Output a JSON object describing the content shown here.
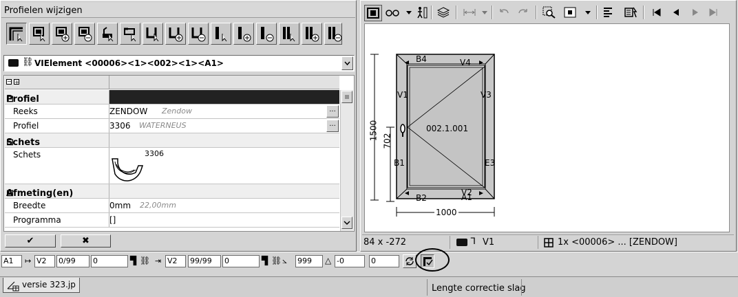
{
  "left_panel": {
    "title": "Profielen wijzigen",
    "toolbar_icons": [
      "frame-select-icon",
      "window-select-icon",
      "window-add-icon",
      "window-remove-icon",
      "sash-select-icon",
      "profile-select-icon",
      "bar-select-icon",
      "bar-add-icon",
      "bar-remove-icon",
      "mullion-select-icon",
      "mullion-add-icon",
      "mullion-remove-icon",
      "double-mullion-select-icon",
      "double-mullion-add-icon",
      "double-mullion-remove-icon"
    ],
    "element_selector": "VIElement <00006><1><002><1><A1>",
    "grid": {
      "profiel_section": "Profiel",
      "reeks_label": "Reeks",
      "reeks_value": "ZENDOW",
      "reeks_hint": "Zendow",
      "profiel_label": "Profiel",
      "profiel_value": "3306",
      "profiel_hint": "WATERNEUS",
      "schets_section": "Schets",
      "schets_label": "Schets",
      "schets_value": "3306",
      "afmeting_section": "Afmeting(en)",
      "breedte_label": "Breedte",
      "breedte_value": "0mm",
      "breedte_hint": "22,00mm",
      "programma_label": "Programma",
      "programma_value": "[]"
    },
    "ok_symbol": "✔",
    "cancel_symbol": "✖"
  },
  "right_panel": {
    "drawing": {
      "labels": {
        "top_left": "B4",
        "top_right": "V4",
        "left_upper": "V1",
        "right_upper": "V3",
        "left_lower": "B1",
        "right_lower": "E3",
        "bottom_left": "B2",
        "bottom_right": "A1",
        "bottom_mid": "V2",
        "center": "002.1.001",
        "height": "1500",
        "handle_height": "702",
        "width": "1000"
      }
    },
    "status": {
      "coords": "84 x -272",
      "profile": "V1",
      "element": "1x <00006> ... [ZENDOW]"
    }
  },
  "bottom_bar": {
    "field1": "A1",
    "field2": "V2",
    "field3": "0/99",
    "field4": "0",
    "field5": "V2",
    "field6": "99/99",
    "field7": "0",
    "field8": "999",
    "field9": "-0",
    "field10": "0"
  },
  "tabs": {
    "file_tab": "versie 323.jp",
    "status_text": "Lengte correctie slag"
  }
}
